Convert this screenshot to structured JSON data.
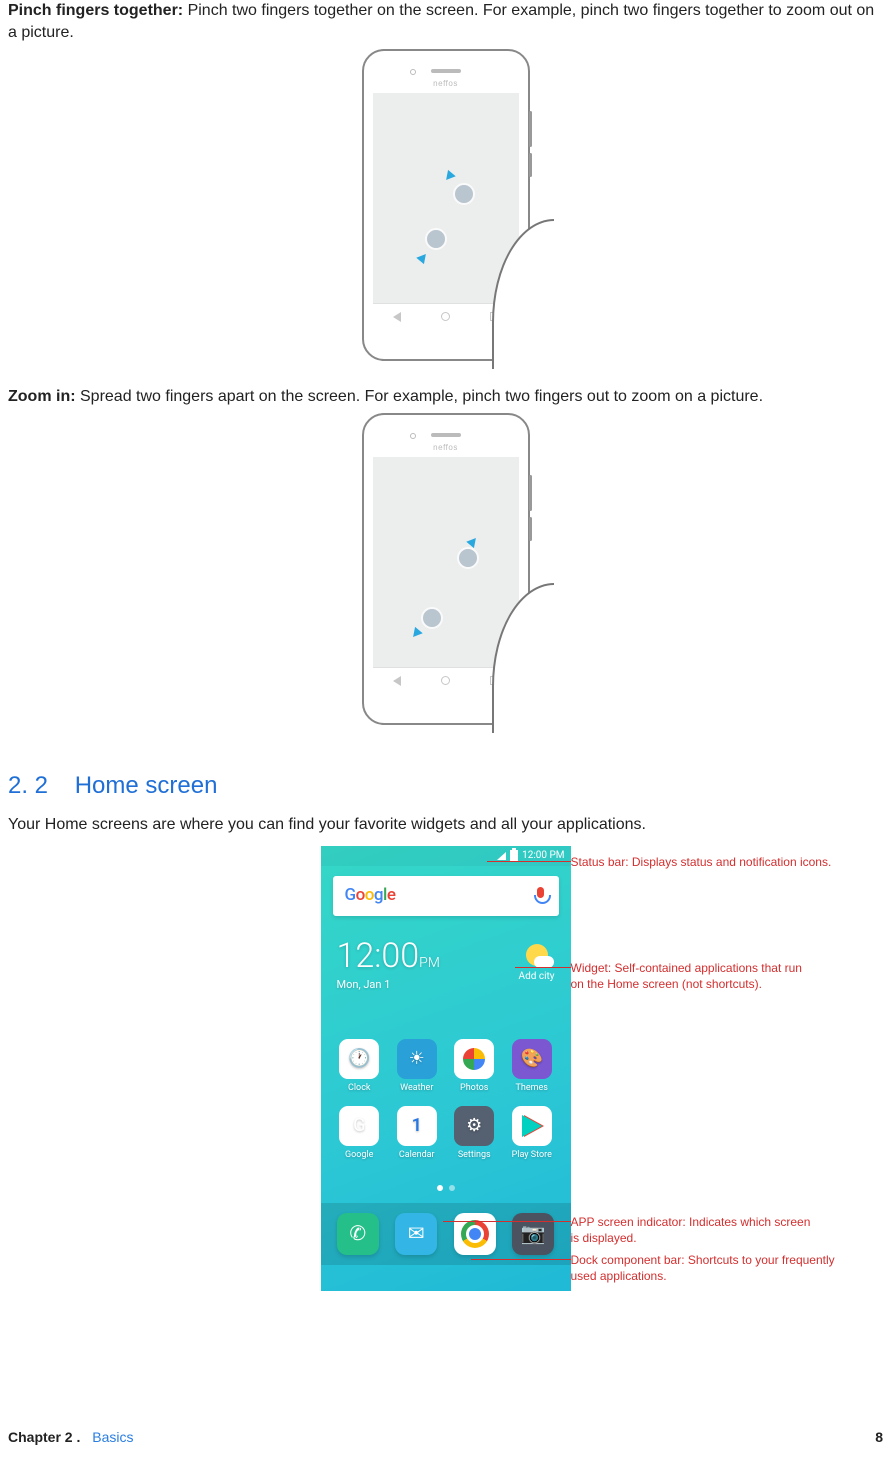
{
  "gesture1": {
    "title": "Pinch fingers together:",
    "text": " Pinch two fingers together on the screen. For example, pinch two fingers together to zoom out on a picture.",
    "brand": "neffos"
  },
  "gesture2": {
    "title": "Zoom in:",
    "text": " Spread two fingers apart on the screen. For example, pinch two fingers out to zoom on a picture.",
    "brand": "neffos"
  },
  "section": {
    "number": "2. 2",
    "title": "Home screen",
    "intro": "Your Home screens are where you can find your favorite widgets and all your applications."
  },
  "homescreen": {
    "time_clock": "12:00",
    "time_ampm": "PM",
    "statusbar_time": "12:00 PM",
    "date": "Mon, Jan 1",
    "search_logo": "Google",
    "weather_label": "Add city",
    "apps_row1": [
      {
        "label": "Clock"
      },
      {
        "label": "Weather"
      },
      {
        "label": "Photos"
      },
      {
        "label": "Themes"
      }
    ],
    "apps_row2": [
      {
        "label": "Google"
      },
      {
        "label": "Calendar",
        "num": "1"
      },
      {
        "label": "Settings"
      },
      {
        "label": "Play Store"
      }
    ]
  },
  "callouts": {
    "status": "Status bar: Displays status and notification icons.",
    "widget_l1": "Widget: Self-contained applications that run",
    "widget_l2": "on the Home screen (not shortcuts).",
    "indicator_l1": "APP screen indicator: Indicates which screen",
    "indicator_l2": "is displayed.",
    "dock_l1": "Dock component bar: Shortcuts to your frequently",
    "dock_l2": "used applications."
  },
  "footer": {
    "chapter": "Chapter 2 .",
    "sub": "Basics",
    "page": "8"
  }
}
